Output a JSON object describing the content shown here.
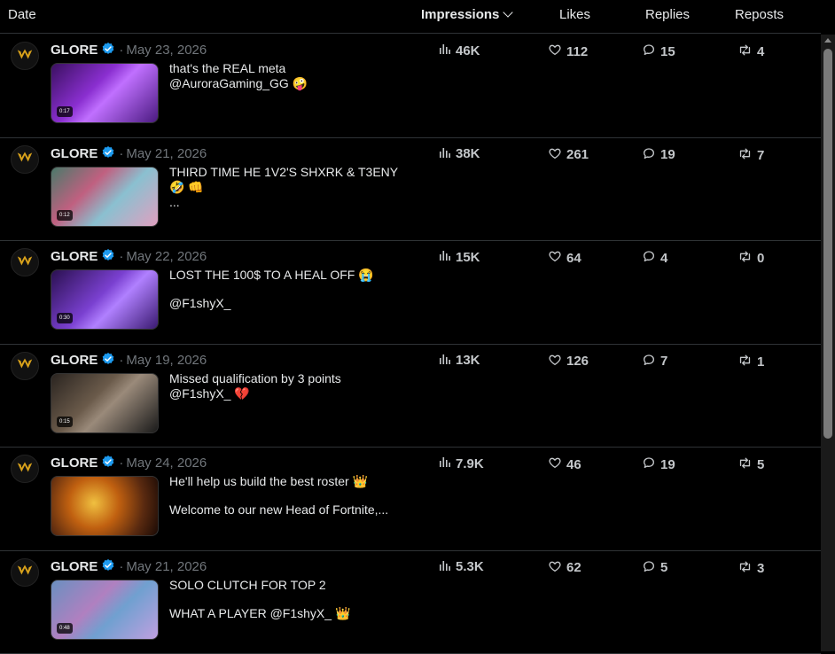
{
  "header": {
    "date": "Date",
    "impressions": "Impressions",
    "likes": "Likes",
    "replies": "Replies",
    "reposts": "Reposts"
  },
  "colors": {
    "verified": "#1d9bf0",
    "logo": "#d9a21b"
  },
  "posts": [
    {
      "author": "GLORE",
      "date": "May 23, 2026",
      "lines": [
        "that's the REAL meta",
        "@AuroraGaming_GG 🤪"
      ],
      "duration": "0:17",
      "impressions": "46K",
      "likes": "112",
      "replies": "15",
      "reposts": "4"
    },
    {
      "author": "GLORE",
      "date": "May 21, 2026",
      "lines": [
        "THIRD TIME HE 1V2'S SHXRK & T3ENY",
        "🤣 👊",
        "..."
      ],
      "duration": "0:12",
      "impressions": "38K",
      "likes": "261",
      "replies": "19",
      "reposts": "7"
    },
    {
      "author": "GLORE",
      "date": "May 22, 2026",
      "lines": [
        "LOST THE 100$ TO A HEAL OFF 😭",
        "",
        "@F1shyX_"
      ],
      "duration": "0:30",
      "impressions": "15K",
      "likes": "64",
      "replies": "4",
      "reposts": "0"
    },
    {
      "author": "GLORE",
      "date": "May 19, 2026",
      "lines": [
        "Missed qualification by 3 points",
        "@F1shyX_ 💔"
      ],
      "duration": "0:15",
      "impressions": "13K",
      "likes": "126",
      "replies": "7",
      "reposts": "1"
    },
    {
      "author": "GLORE",
      "date": "May 24, 2026",
      "lines": [
        "He'll help us build the best roster 👑",
        "",
        "Welcome to our new Head of Fortnite,..."
      ],
      "duration": "",
      "impressions": "7.9K",
      "likes": "46",
      "replies": "19",
      "reposts": "5"
    },
    {
      "author": "GLORE",
      "date": "May 21, 2026",
      "lines": [
        "SOLO CLUTCH FOR TOP 2",
        "",
        "WHAT A PLAYER @F1shyX_ 👑"
      ],
      "duration": "0:48",
      "impressions": "5.3K",
      "likes": "62",
      "replies": "5",
      "reposts": "3"
    }
  ]
}
